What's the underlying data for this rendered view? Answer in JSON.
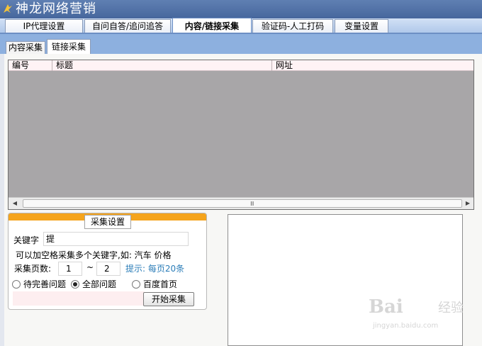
{
  "window": {
    "title": "神龙网络营销",
    "logo_icon": "app-logo-icon"
  },
  "main_tabs": [
    {
      "label": "IP代理设置"
    },
    {
      "label": "自问自答/追问追答"
    },
    {
      "label": "内容/链接采集"
    },
    {
      "label": "验证码-人工打码"
    },
    {
      "label": "变量设置"
    }
  ],
  "sub_tabs": [
    {
      "label": "内容采集"
    },
    {
      "label": "链接采集"
    }
  ],
  "grid": {
    "columns": [
      "编号",
      "标题",
      "网址"
    ],
    "rows": [],
    "scroll_grip": "Ⅲ"
  },
  "settings": {
    "legend": "采集设置",
    "keyword_label": "关键字",
    "keyword_value": "提",
    "keyword_tip": "可以加空格采集多个关键字,如: 汽车   价格",
    "pages_label": "采集页数:",
    "pages_from": "1",
    "pages_sep": "~",
    "pages_to": "2",
    "pages_hint": "提示: 每页20条",
    "radios": [
      {
        "label": "待完善问题",
        "checked": false
      },
      {
        "label": "全部问题",
        "checked": true
      },
      {
        "label": "百度首页",
        "checked": false
      }
    ],
    "start_button": "开始采集"
  },
  "watermark": {
    "logo": "Bai",
    "text": "经验",
    "url": "jingyan.baidu.com"
  },
  "colors": {
    "title_bar": "#4f70a6",
    "settings_accent": "#f5a41c",
    "grid_bg": "#a8a6a8",
    "hint": "#2b7db8"
  }
}
